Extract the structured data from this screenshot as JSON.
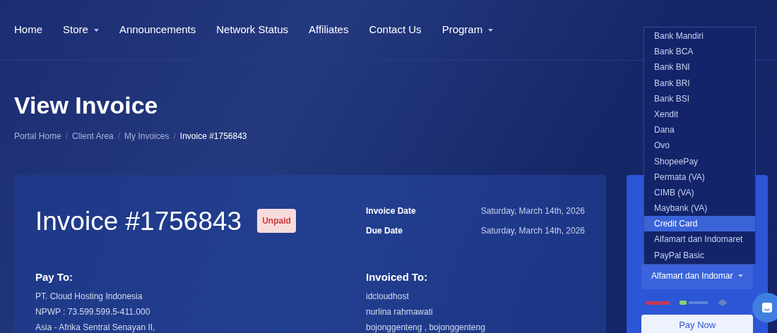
{
  "nav": [
    {
      "label": "Home",
      "has_menu": false
    },
    {
      "label": "Store",
      "has_menu": true
    },
    {
      "label": "Announcements",
      "has_menu": false
    },
    {
      "label": "Network Status",
      "has_menu": false
    },
    {
      "label": "Affiliates",
      "has_menu": false
    },
    {
      "label": "Contact Us",
      "has_menu": false
    },
    {
      "label": "Program",
      "has_menu": true
    }
  ],
  "page_title": "View Invoice",
  "breadcrumb_separator": "/",
  "breadcrumb": [
    {
      "label": "Portal Home",
      "current": false
    },
    {
      "label": "Client Area",
      "current": false
    },
    {
      "label": "My Invoices",
      "current": false
    },
    {
      "label": "Invoice #1756843",
      "current": true
    }
  ],
  "invoice": {
    "title": "Invoice #1756843",
    "status": "Unpaid",
    "dates": [
      {
        "label": "Invoice Date",
        "value": "Saturday, March 14th, 2026"
      },
      {
        "label": "Due Date",
        "value": "Saturday, March 14th, 2026"
      }
    ],
    "pay_to": {
      "heading": "Pay To:",
      "lines": [
        "PT. Cloud Hosting Indonesia",
        "NPWP : 73.599.599.5-411.000",
        "Asia - Afrika Sentral Senayan II,"
      ]
    },
    "invoiced_to": {
      "heading": "Invoiced To:",
      "lines": [
        "idcloudhost",
        "nurlina rahmawati",
        "bojonggenteng , bojonggenteng"
      ]
    }
  },
  "payment": {
    "select_value": "Alfamart dan Indomar",
    "button": "Pay Now",
    "options": [
      {
        "label": "Bank Mandiri",
        "selected": false
      },
      {
        "label": "Bank BCA",
        "selected": false
      },
      {
        "label": "Bank BNI",
        "selected": false
      },
      {
        "label": "Bank BRI",
        "selected": false
      },
      {
        "label": "Bank BSI",
        "selected": false
      },
      {
        "label": "Xendit",
        "selected": false
      },
      {
        "label": "Dana",
        "selected": false
      },
      {
        "label": "Ovo",
        "selected": false
      },
      {
        "label": "ShopeePay",
        "selected": false
      },
      {
        "label": "Permata (VA)",
        "selected": false
      },
      {
        "label": "CIMB (VA)",
        "selected": false
      },
      {
        "label": "Maybank (VA)",
        "selected": false
      },
      {
        "label": "Credit Card",
        "selected": true
      },
      {
        "label": "Alfamart dan Indomaret",
        "selected": false
      },
      {
        "label": "PayPal Basic",
        "selected": false
      }
    ]
  }
}
